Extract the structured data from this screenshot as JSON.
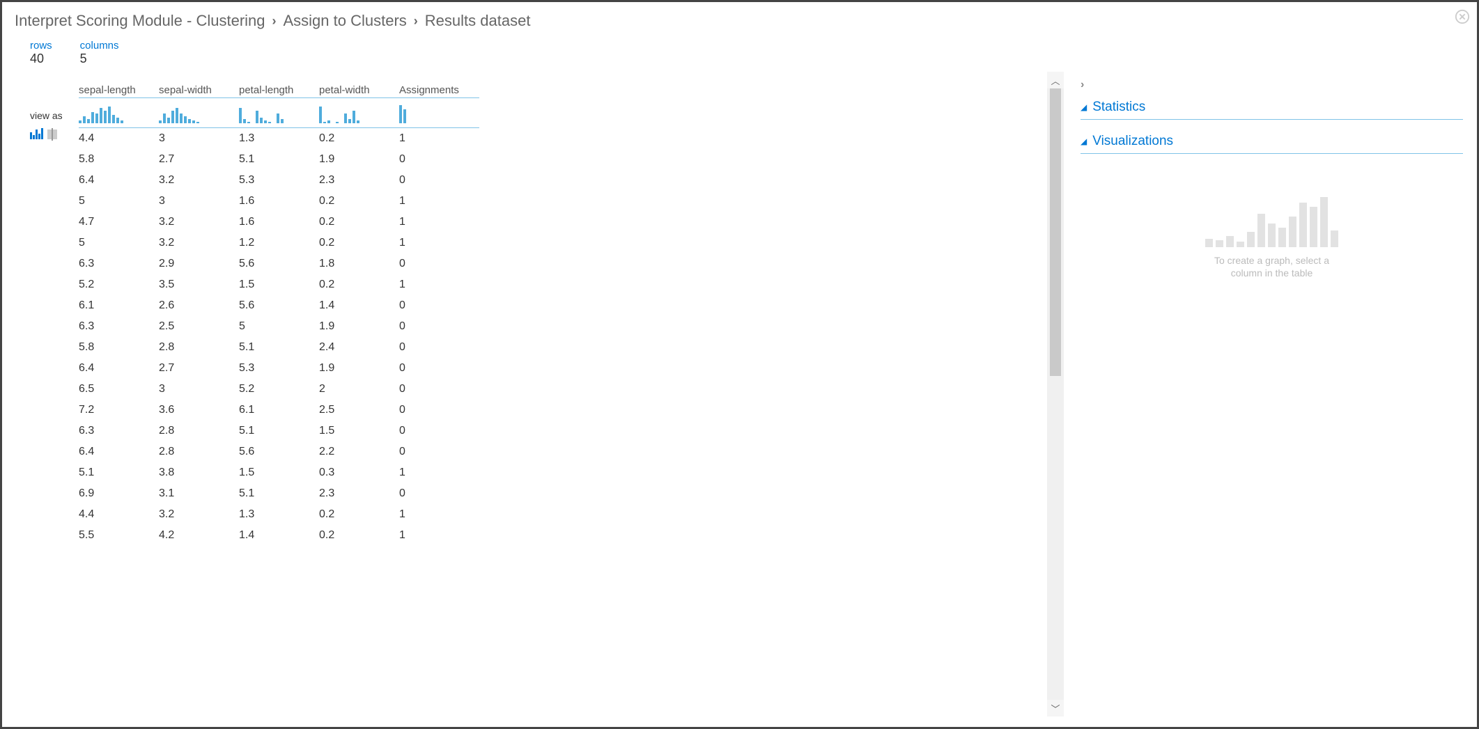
{
  "breadcrumb": {
    "part1": "Interpret Scoring Module - Clustering",
    "part2": "Assign to Clusters",
    "part3": "Results dataset"
  },
  "meta": {
    "rows_label": "rows",
    "rows_value": "40",
    "cols_label": "columns",
    "cols_value": "5"
  },
  "view_as_label": "view as",
  "columns": [
    "sepal-length",
    "sepal-width",
    "petal-length",
    "petal-width",
    "Assignments"
  ],
  "histograms": [
    [
      4,
      10,
      6,
      16,
      14,
      22,
      18,
      24,
      12,
      8,
      4
    ],
    [
      4,
      14,
      8,
      18,
      22,
      14,
      10,
      6,
      4,
      2
    ],
    [
      22,
      6,
      2,
      0,
      18,
      8,
      4,
      2,
      0,
      14,
      6
    ],
    [
      24,
      2,
      4,
      0,
      2,
      0,
      14,
      6,
      18,
      4
    ],
    [
      26,
      20
    ]
  ],
  "rows": [
    [
      "4.4",
      "3",
      "1.3",
      "0.2",
      "1"
    ],
    [
      "5.8",
      "2.7",
      "5.1",
      "1.9",
      "0"
    ],
    [
      "6.4",
      "3.2",
      "5.3",
      "2.3",
      "0"
    ],
    [
      "5",
      "3",
      "1.6",
      "0.2",
      "1"
    ],
    [
      "4.7",
      "3.2",
      "1.6",
      "0.2",
      "1"
    ],
    [
      "5",
      "3.2",
      "1.2",
      "0.2",
      "1"
    ],
    [
      "6.3",
      "2.9",
      "5.6",
      "1.8",
      "0"
    ],
    [
      "5.2",
      "3.5",
      "1.5",
      "0.2",
      "1"
    ],
    [
      "6.1",
      "2.6",
      "5.6",
      "1.4",
      "0"
    ],
    [
      "6.3",
      "2.5",
      "5",
      "1.9",
      "0"
    ],
    [
      "5.8",
      "2.8",
      "5.1",
      "2.4",
      "0"
    ],
    [
      "6.4",
      "2.7",
      "5.3",
      "1.9",
      "0"
    ],
    [
      "6.5",
      "3",
      "5.2",
      "2",
      "0"
    ],
    [
      "7.2",
      "3.6",
      "6.1",
      "2.5",
      "0"
    ],
    [
      "6.3",
      "2.8",
      "5.1",
      "1.5",
      "0"
    ],
    [
      "6.4",
      "2.8",
      "5.6",
      "2.2",
      "0"
    ],
    [
      "5.1",
      "3.8",
      "1.5",
      "0.3",
      "1"
    ],
    [
      "6.9",
      "3.1",
      "5.1",
      "2.3",
      "0"
    ],
    [
      "4.4",
      "3.2",
      "1.3",
      "0.2",
      "1"
    ],
    [
      "5.5",
      "4.2",
      "1.4",
      "0.2",
      "1"
    ]
  ],
  "right": {
    "statistics_label": "Statistics",
    "visualizations_label": "Visualizations",
    "placeholder_line1": "To create a graph, select a",
    "placeholder_line2": "column in the table"
  },
  "placeholder_bars": [
    12,
    10,
    16,
    8,
    22,
    48,
    34,
    28,
    44,
    64,
    58,
    72,
    24
  ]
}
